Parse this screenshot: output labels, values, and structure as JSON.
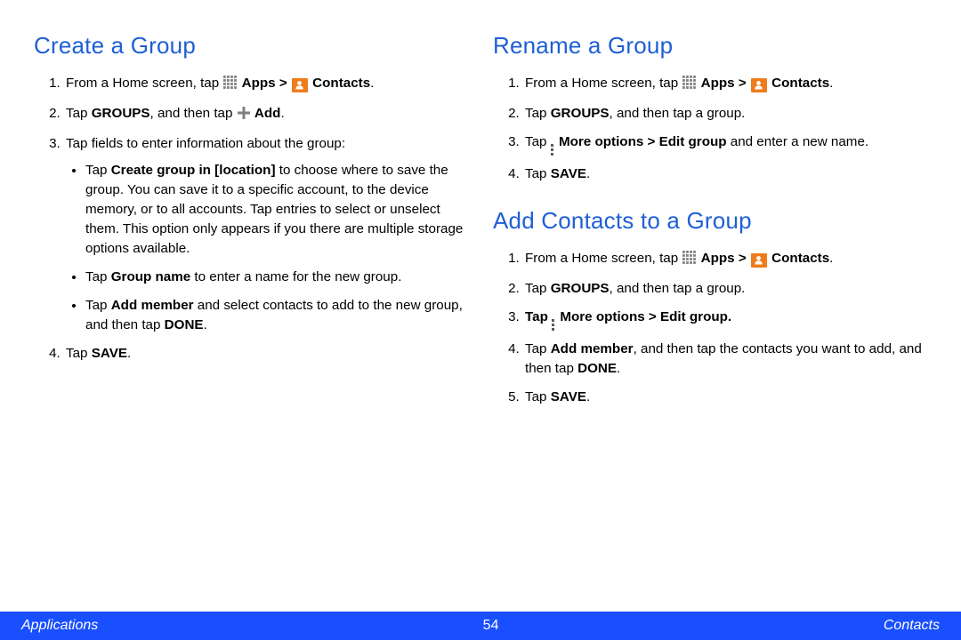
{
  "page_number": "54",
  "footer": {
    "left": "Applications",
    "right": "Contacts"
  },
  "icons": {
    "apps": "apps-grid-icon",
    "contact": "contact-icon",
    "plus": "plus-icon",
    "more": "more-options-icon"
  },
  "left": {
    "section1": {
      "title": "Create a Group",
      "step1_pre": "From a Home screen, tap ",
      "step1_apps": "Apps",
      "step1_gt": " > ",
      "step1_contacts": "Contacts",
      "step1_post": ".",
      "step2_pre": "Tap ",
      "step2_groups": "GROUPS",
      "step2_mid": ", and then tap ",
      "step2_add": "Add",
      "step2_post": ".",
      "step3": "Tap fields to enter information about the group:",
      "b1_pre": "Tap ",
      "b1_bold": "Create group in [location]",
      "b1_post": " to choose where to save the group. You can save it to a specific account, to the device memory, or to all accounts. Tap entries to select or unselect them. This option only appears if you there are multiple storage options available.",
      "b2_pre": "Tap ",
      "b2_bold": "Group name",
      "b2_post": " to enter a name for the new group.",
      "b3_pre": "Tap ",
      "b3_bold": "Add member",
      "b3_mid": " and select contacts to add to the new group, and then tap ",
      "b3_done": "DONE",
      "b3_post": ".",
      "step4_pre": "Tap ",
      "step4_save": "SAVE",
      "step4_post": "."
    }
  },
  "right": {
    "section1": {
      "title": "Rename a Group",
      "step1_pre": "From a Home screen, tap ",
      "step1_apps": "Apps",
      "step1_gt": " > ",
      "step1_contacts": "Contacts",
      "step1_post": ".",
      "step2_pre": "Tap ",
      "step2_groups": "GROUPS",
      "step2_post": ", and then tap a group.",
      "step3_pre": "Tap ",
      "step3_bold": "More options > Edit group",
      "step3_post": " and enter a new name.",
      "step4_pre": "Tap ",
      "step4_save": "SAVE",
      "step4_post": "."
    },
    "section2": {
      "title": "Add Contacts to a Group",
      "step1_pre": "From a Home screen, tap ",
      "step1_apps": "Apps",
      "step1_gt": " > ",
      "step1_contacts": "Contacts",
      "step1_post": ".",
      "step2_pre": "Tap ",
      "step2_groups": "GROUPS",
      "step2_post": ", and then tap a group.",
      "step3_pre": "Tap ",
      "step3_bold": "More options > Edit group",
      "step3_post": ".",
      "step4_pre": "Tap ",
      "step4_bold": "Add member",
      "step4_mid": ", and then tap the contacts you want to add, and then tap ",
      "step4_done": "DONE",
      "step4_post": ".",
      "step5_pre": "Tap ",
      "step5_save": "SAVE",
      "step5_post": "."
    }
  }
}
